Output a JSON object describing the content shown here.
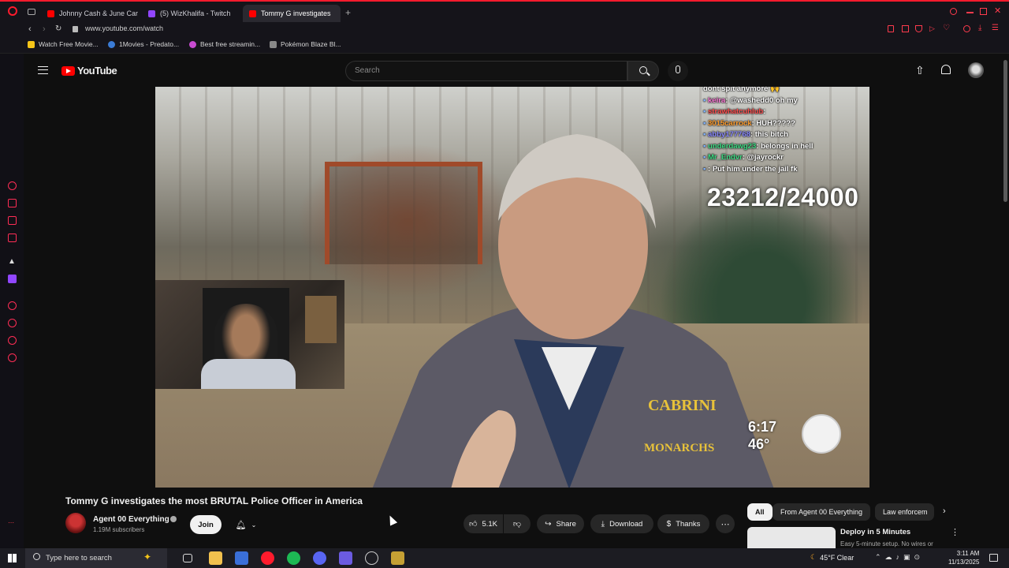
{
  "browser": {
    "tabs": [
      {
        "title": "Johnny Cash & June Car",
        "color": "#ff0000"
      },
      {
        "title": "(5) WizKhalifa - Twitch",
        "color": "#9146ff"
      },
      {
        "title": "Tommy G investigates",
        "color": "#ff0000"
      }
    ],
    "address": "www.youtube.com/watch",
    "bookmarks": [
      {
        "label": "Watch Free Movie...",
        "color": "#f5c518"
      },
      {
        "label": "1Movies - Predato...",
        "color": "#3a7bd5"
      },
      {
        "label": "Best free streamin...",
        "color": "#c84bd1"
      },
      {
        "label": "Pokémon Blaze Bl...",
        "color": "#888888"
      }
    ]
  },
  "youtube": {
    "logo_text": "YouTube",
    "search_placeholder": "Search"
  },
  "stream_overlay": {
    "chat": [
      {
        "user": "",
        "user_color": "#ffffff",
        "text": "dont spit anymore 🙌"
      },
      {
        "user": "keira",
        "user_color": "#ff7ad9",
        "text": ": @washedd0 oh my"
      },
      {
        "user": "strawhatcuhlub",
        "user_color": "#ff4d4d",
        "text": ":"
      },
      {
        "user": "3015carrock",
        "user_color": "#ff9d2e",
        "text": ": HUH?????"
      },
      {
        "user": "abby177768",
        "user_color": "#8a8aff",
        "text": ": this bitch"
      },
      {
        "user": "underdawg23",
        "user_color": "#3ddc84",
        "text": ": belongs in hell"
      },
      {
        "user": "Mr_Endvr",
        "user_color": "#3ddc84",
        "text": ": @jayrockr"
      },
      {
        "user": "",
        "user_color": "#a970ff",
        "text": ": Put him under the jail fk"
      }
    ],
    "counter": "23212/24000",
    "time": "6:17",
    "temp": "46°"
  },
  "video_info": {
    "title": "Tommy G investigates the most BRUTAL Police Officer in America",
    "channel_name": "Agent 00 Everything",
    "subscribers": "1.19M subscribers",
    "join_label": "Join",
    "likes": "5.1K",
    "share_label": "Share",
    "download_label": "Download",
    "thanks_label": "Thanks"
  },
  "recommendations": {
    "chips": [
      "All",
      "From Agent 00 Everything",
      "Law enforcem"
    ],
    "first_title": "Deploy in 5 Minutes",
    "first_sub": "Easy 5-minute setup. No wires or"
  },
  "taskbar": {
    "search_placeholder": "Type here to search",
    "weather": "45°F  Clear",
    "time": "3:11 AM",
    "date": "11/13/2025"
  }
}
